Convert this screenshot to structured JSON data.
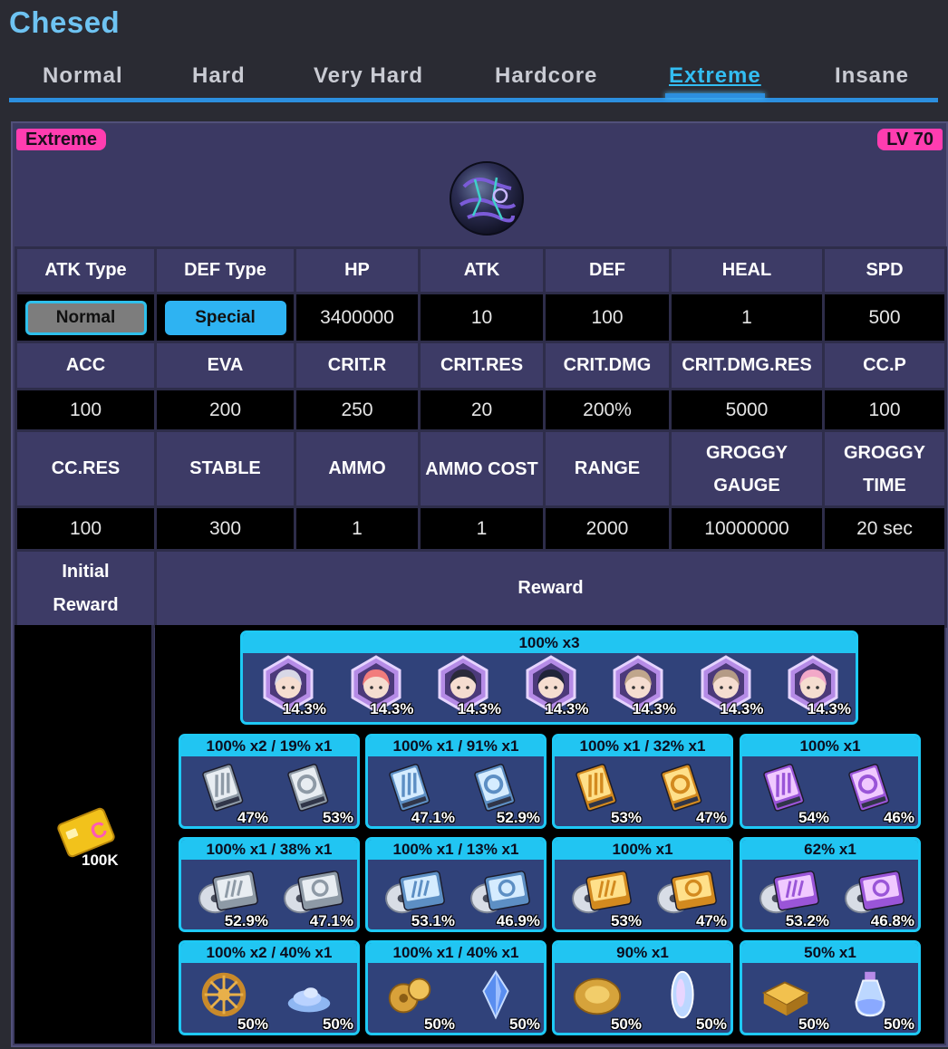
{
  "boss_name": "Chesed",
  "tabs": [
    {
      "label": "Normal",
      "active": false
    },
    {
      "label": "Hard",
      "active": false
    },
    {
      "label": "Very Hard",
      "active": false
    },
    {
      "label": "Hardcore",
      "active": false
    },
    {
      "label": "Extreme",
      "active": true
    },
    {
      "label": "Insane",
      "active": false
    }
  ],
  "banner": {
    "difficulty": "Extreme",
    "level": "LV 70"
  },
  "stats": {
    "row1_headers": [
      "ATK Type",
      "DEF Type",
      "HP",
      "ATK",
      "DEF",
      "HEAL",
      "SPD"
    ],
    "atk_type": "Normal",
    "def_type": "Special",
    "row1_values": [
      "3400000",
      "10",
      "100",
      "1",
      "500"
    ],
    "row2_headers": [
      "ACC",
      "EVA",
      "CRIT.R",
      "CRIT.RES",
      "CRIT.DMG",
      "CRIT.DMG.RES",
      "CC.P"
    ],
    "row2_values": [
      "100",
      "200",
      "250",
      "20",
      "200%",
      "5000",
      "100"
    ],
    "row3_headers": [
      "CC.RES",
      "STABLE",
      "AMMO",
      "AMMO COST",
      "RANGE",
      "GROGGY GAUGE",
      "GROGGY TIME"
    ],
    "row3_values": [
      "100",
      "300",
      "1",
      "1",
      "2000",
      "10000000",
      "20 sec"
    ],
    "initial_reward_label": "Initial Reward",
    "reward_label": "Reward"
  },
  "initial_reward": {
    "amount": "100K"
  },
  "colors": {
    "accent": "#2c8fdf",
    "badge": "#ff3db0",
    "reward_border": "#1ec9f5",
    "header_bg": "#3d3b66"
  },
  "character_drop": {
    "header": "100% x3",
    "items": [
      "14.3%",
      "14.3%",
      "14.3%",
      "14.3%",
      "14.3%",
      "14.3%",
      "14.3%"
    ]
  },
  "reward_rows": [
    [
      {
        "header": "100% x2 / 19% x1",
        "tier": "silver",
        "kind": "doc",
        "items": [
          "47%",
          "53%"
        ]
      },
      {
        "header": "100% x1 / 91% x1",
        "tier": "blue",
        "kind": "doc",
        "items": [
          "47.1%",
          "52.9%"
        ]
      },
      {
        "header": "100% x1 / 32% x1",
        "tier": "gold",
        "kind": "doc",
        "items": [
          "53%",
          "47%"
        ]
      },
      {
        "header": "100% x1",
        "tier": "purple",
        "kind": "doc",
        "items": [
          "54%",
          "46%"
        ]
      }
    ],
    [
      {
        "header": "100% x1 / 38% x1",
        "tier": "silver",
        "kind": "disc",
        "items": [
          "52.9%",
          "47.1%"
        ]
      },
      {
        "header": "100% x1 / 13% x1",
        "tier": "blue",
        "kind": "disc",
        "items": [
          "53.1%",
          "46.9%"
        ]
      },
      {
        "header": "100% x1",
        "tier": "gold",
        "kind": "disc",
        "items": [
          "53%",
          "47%"
        ]
      },
      {
        "header": "62% x1",
        "tier": "purple",
        "kind": "disc",
        "items": [
          "53.2%",
          "46.8%"
        ]
      }
    ],
    [
      {
        "header": "100% x2 / 40% x1",
        "tier": "misc1",
        "kind": "misc",
        "items": [
          "50%",
          "50%"
        ]
      },
      {
        "header": "100% x1 / 40% x1",
        "tier": "misc2",
        "kind": "misc",
        "items": [
          "50%",
          "50%"
        ]
      },
      {
        "header": "90% x1",
        "tier": "misc3",
        "kind": "misc",
        "items": [
          "50%",
          "50%"
        ]
      },
      {
        "header": "50% x1",
        "tier": "misc4",
        "kind": "misc",
        "items": [
          "50%",
          "50%"
        ]
      }
    ]
  ]
}
